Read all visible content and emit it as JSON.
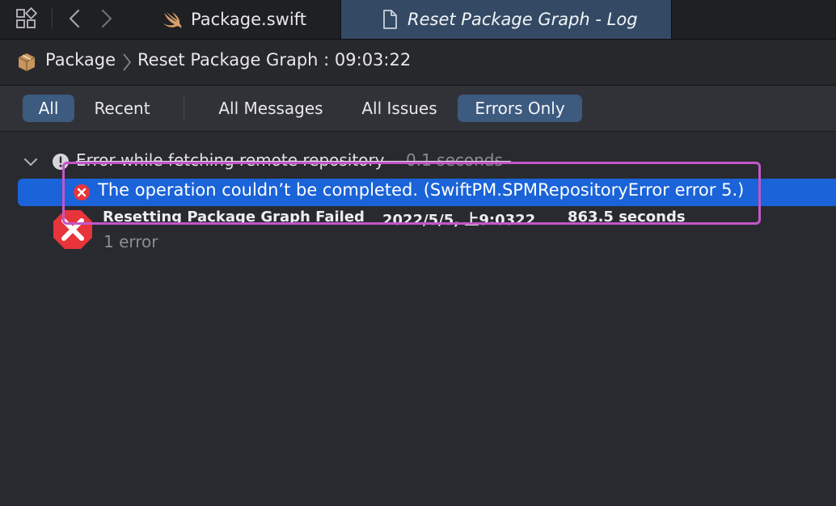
{
  "tabs": [
    {
      "label": "Package.swift",
      "icon": "swift-icon"
    },
    {
      "label": "Reset Package Graph - Log",
      "icon": "document-icon",
      "active": true
    }
  ],
  "breadcrumb": {
    "root": "Package",
    "current": "Reset Package Graph : 09:03:22"
  },
  "filters": {
    "scope": [
      "All",
      "Recent"
    ],
    "scope_selected": "All",
    "types": [
      "All Messages",
      "All Issues",
      "Errors Only"
    ],
    "type_selected": "Errors Only"
  },
  "log": {
    "parent": {
      "title": "Error while fetching remote repository",
      "duration": "0.1 seconds"
    },
    "selected_error": "The operation couldn’t be completed. (SwiftPM.SPMRepositoryError error 5.)",
    "summary": {
      "title": "Resetting Package Graph Failed",
      "date": "2022/5/5, 上9:0322",
      "duration": "863.5 seconds",
      "count": "1 error"
    }
  },
  "colors": {
    "selection": "#1a63d8",
    "error": "#e8343b",
    "highlight": "#c356c8",
    "active_filter": "#3d5a7f",
    "active_tab": "#344a64"
  }
}
